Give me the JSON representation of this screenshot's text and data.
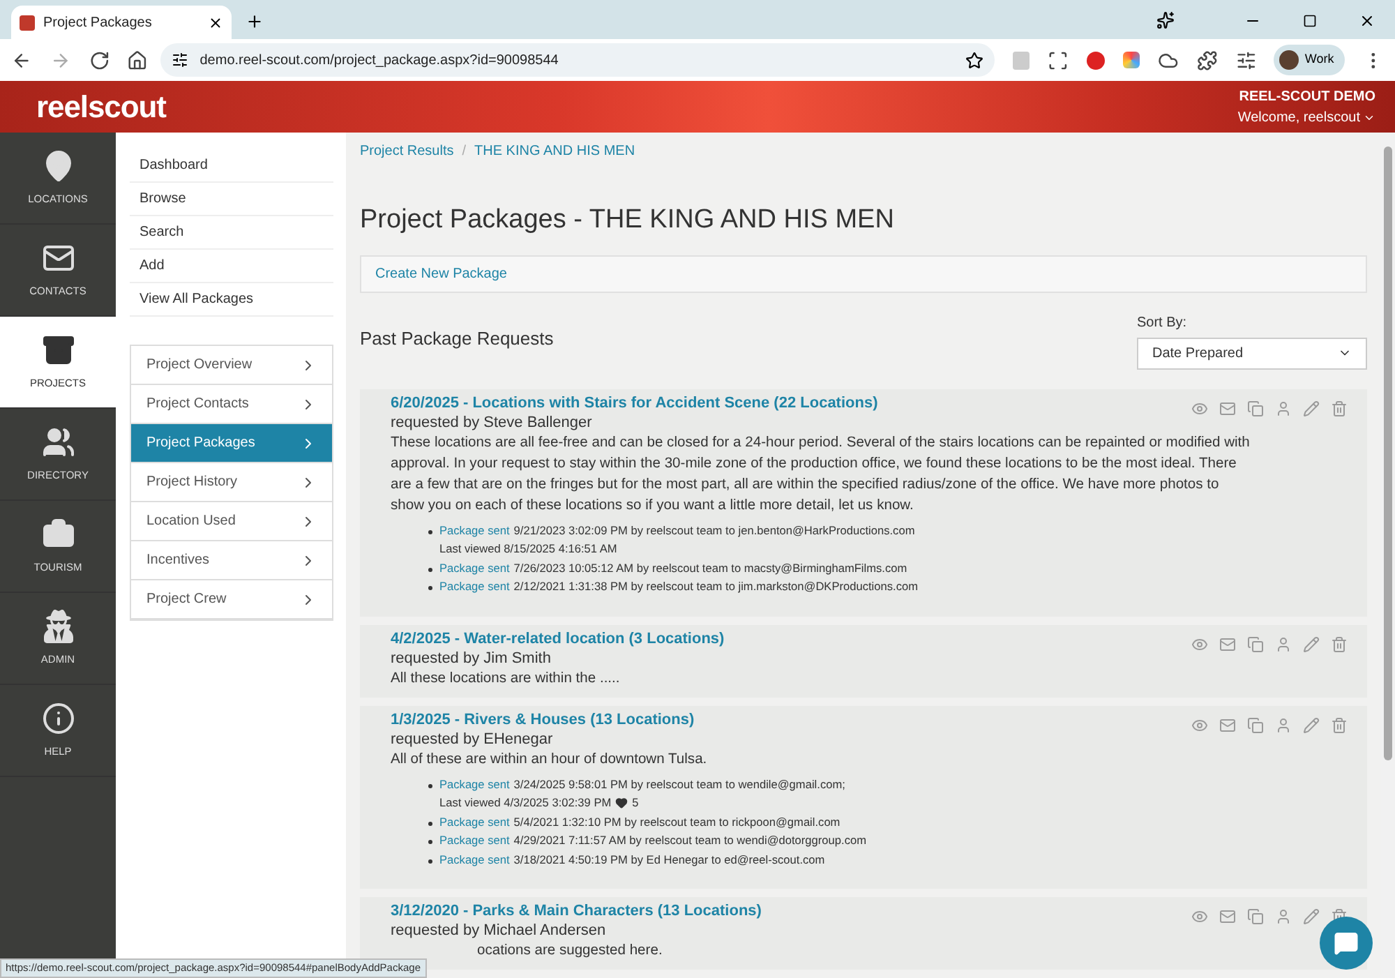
{
  "browser": {
    "tab_title": "Project Packages",
    "url": "demo.reel-scout.com/project_package.aspx?id=90098544",
    "profile": "Work"
  },
  "header": {
    "logo": "reelscout",
    "account": "REEL-SCOUT DEMO",
    "welcome": "Welcome, reelscout"
  },
  "nav": [
    {
      "label": "LOCATIONS",
      "kind": "pin",
      "selected": false
    },
    {
      "label": "CONTACTS",
      "kind": "mail",
      "selected": false
    },
    {
      "label": "PROJECTS",
      "kind": "box",
      "selected": true
    },
    {
      "label": "DIRECTORY",
      "kind": "people",
      "selected": false
    },
    {
      "label": "TOURISM",
      "kind": "luggage",
      "selected": false
    },
    {
      "label": "ADMIN",
      "kind": "spy",
      "selected": false
    },
    {
      "label": "HELP",
      "kind": "info",
      "selected": false
    }
  ],
  "submenu": [
    "Dashboard",
    "Browse",
    "Search",
    "Add",
    "View All Packages"
  ],
  "project_menu": [
    {
      "label": "Project Overview",
      "selected": false
    },
    {
      "label": "Project Contacts",
      "selected": false
    },
    {
      "label": "Project Packages",
      "selected": true
    },
    {
      "label": "Project History",
      "selected": false
    },
    {
      "label": "Location Used",
      "selected": false
    },
    {
      "label": "Incentives",
      "selected": false
    },
    {
      "label": "Project Crew",
      "selected": false
    }
  ],
  "breadcrumb": [
    "Project Results",
    "THE KING AND HIS MEN"
  ],
  "breadcrumb_separator": "/",
  "title": "Project Packages - THE KING AND HIS MEN",
  "create_link": "Create New Package",
  "past_heading": "Past Package Requests",
  "sort": {
    "label": "Sort By:",
    "value": "Date Prepared"
  },
  "packages": [
    {
      "title": "6/20/2025 - Locations with Stairs for Accident Scene (22 Locations)",
      "requested_by": "requested by Steve Ballenger",
      "description": "These locations are all fee-free and can be closed for a 24-hour period. Several of the stairs locations can be repainted or modified with approval. In your request to stay within the 30-mile zone of the production office, we found these locations to be the most ideal. There are a few that are on the fringes but for the most part, all are within the specified radius/zone of the office. We have more photos to show you on each of these locations so if you want a little more detail, let us know.",
      "sends": [
        {
          "link": "Package sent",
          "details": "9/21/2023 3:02:09 PM by reelscout team to jen.benton@HarkProductions.com",
          "last_viewed": "Last viewed 8/15/2025 4:16:51 AM"
        },
        {
          "link": "Package sent",
          "details": "7/26/2023 10:05:12 AM by reelscout team to macsty@BirminghamFilms.com"
        },
        {
          "link": "Package sent",
          "details": "2/12/2021 1:31:38 PM by reelscout team to jim.markston@DKProductions.com"
        }
      ]
    },
    {
      "title": "4/2/2025 - Water-related location (3 Locations)",
      "requested_by": "requested by Jim Smith",
      "description": "All these locations are within the ....."
    },
    {
      "title": "1/3/2025 - Rivers & Houses (13 Locations)",
      "requested_by": "requested by EHenegar",
      "description": "All of these are within an hour of downtown Tulsa.",
      "sends": [
        {
          "link": "Package sent",
          "details": "3/24/2025 9:58:01 PM by reelscout team to wendile@gmail.com;",
          "last_viewed": "Last viewed 4/3/2025 3:02:39 PM",
          "likes": "5"
        },
        {
          "link": "Package sent",
          "details": "5/4/2021 1:32:10 PM by reelscout team to rickpoon@gmail.com"
        },
        {
          "link": "Package sent",
          "details": "4/29/2021 7:11:57 AM by reelscout team to wendi@dotorggroup.com"
        },
        {
          "link": "Package sent",
          "details": "3/18/2021 4:50:19 PM by Ed Henegar to ed@reel-scout.com"
        }
      ]
    },
    {
      "title": "3/12/2020 - Parks & Main Characters (13 Locations)",
      "requested_by": "requested by Michael Andersen",
      "description": "ocations are suggested here."
    }
  ],
  "status_url": "https://demo.reel-scout.com/project_package.aspx?id=90098544#panelBodyAddPackage"
}
